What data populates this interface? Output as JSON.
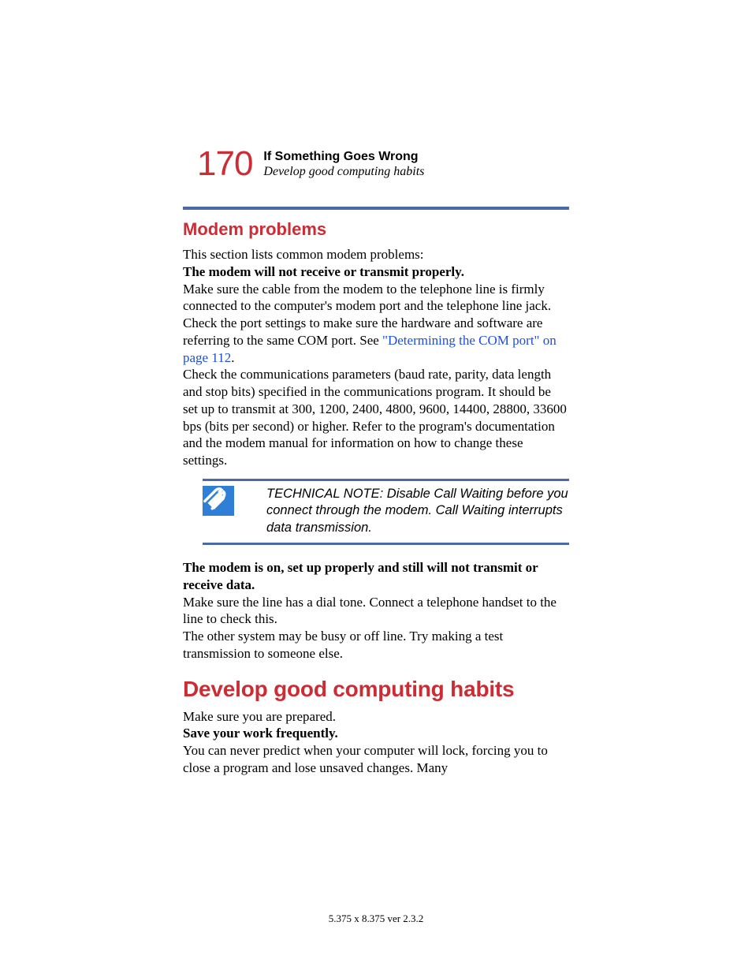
{
  "header": {
    "page_number": "170",
    "chapter": "If Something Goes Wrong",
    "section_hint": "Develop good computing habits"
  },
  "section1": {
    "heading": "Modem problems",
    "intro": "This section lists common modem problems:",
    "sub1_title": "The modem will not receive or transmit properly.",
    "sub1_p1": "Make sure the cable from the modem to the telephone line is firmly connected to the computer's modem port and the telephone line jack.",
    "sub1_p2_a": "Check the port settings to make sure the hardware and software are referring to the same COM port. See ",
    "sub1_p2_link": "\"Determining the COM port\" on page 112",
    "sub1_p2_b": ".",
    "sub1_p3": "Check the communications parameters (baud rate, parity, data length and stop bits) specified in the communications program. It should be set up to transmit at 300, 1200, 2400, 4800, 9600, 14400, 28800, 33600 bps (bits per second) or higher. Refer to the program's documentation and the modem manual for information on how to change these settings.",
    "tech_note": "TECHNICAL NOTE: Disable Call Waiting before you connect through the modem. Call Waiting interrupts data transmission.",
    "sub2_title": "The modem is on, set up properly and still will not transmit or receive data.",
    "sub2_p1": "Make sure the line has a dial tone. Connect a telephone handset to the line to check this.",
    "sub2_p2": "The other system may be busy or off line. Try making a test transmission to someone else."
  },
  "section2": {
    "heading": "Develop good computing habits",
    "p1": "Make sure you are prepared.",
    "sub1_title": "Save your work frequently.",
    "sub1_p1": "You can never predict when your computer will lock, forcing you to close a program and lose unsaved changes. Many"
  },
  "footer": "5.375 x 8.375 ver 2.3.2"
}
